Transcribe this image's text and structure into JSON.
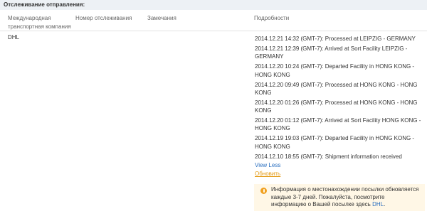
{
  "section": {
    "title": "Отслеживание отправления:"
  },
  "table": {
    "headers": {
      "carrier": "Международная транспортная компания",
      "tracking": "Номер отслеживания",
      "notes": "Замечания",
      "details": "Подробности"
    },
    "row": {
      "carrier": "DHL",
      "tracking": "",
      "notes": "",
      "events": [
        "2014.12.21 14:32 (GMT-7): Processed at LEIPZIG - GERMANY",
        "2014.12.21 12:39 (GMT-7): Arrived at Sort Facility LEIPZIG - GERMANY",
        "2014.12.20 10:24 (GMT-7): Departed Facility in HONG KONG - HONG KONG",
        "2014.12.20 09:49 (GMT-7): Processed at HONG KONG - HONG KONG",
        "2014.12.20 01:26 (GMT-7): Processed at HONG KONG - HONG KONG",
        "2014.12.20 01:12 (GMT-7): Arrived at Sort Facility HONG KONG - HONG KONG",
        "2014.12.19 19:03 (GMT-7): Departed Facility in HONG KONG - HONG KONG",
        "2014.12.10 18:55 (GMT-7): Shipment information received"
      ],
      "view_less": "View Less",
      "refresh": "Обновить"
    }
  },
  "notice": {
    "icon": "info-icon",
    "text": "Информация о местонахождении посылки обновляется каждые 3-7 дней. Пожалуйста, посмотрите информацию о Вашей посылке здесь",
    "link": "DHL",
    "end": "."
  },
  "colors": {
    "header_bg": "#edf1f5",
    "link": "#2a6fc0",
    "refresh": "#e49a12",
    "notice_bg": "#fff7e6",
    "notice_icon": "#f0a020"
  }
}
